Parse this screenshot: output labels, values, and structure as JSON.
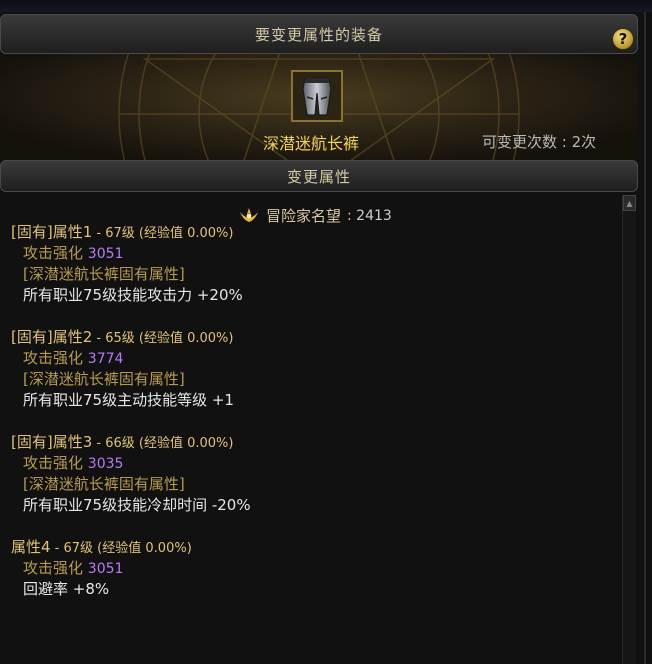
{
  "window": {
    "title": "要变更属性的装备",
    "help_label": "?",
    "help_icon": "question-icon"
  },
  "item": {
    "name": "深潜迷航长裤",
    "change_count": "可变更次数 : 2次",
    "icon": "pants-icon"
  },
  "section": {
    "title": "变更属性"
  },
  "reputation": {
    "label": "冒险家名望",
    "value": ": 2413",
    "icon": "reputation-icon"
  },
  "attributes": [
    {
      "header": "[固有]属性1",
      "level": " - 67级 (经验值 ",
      "exp": "0.00%)",
      "stat_label": "攻击强化",
      "stat_value": "3051",
      "source": "[深潜迷航长裤固有属性]",
      "effect": "所有职业75级技能攻击力 +20%"
    },
    {
      "header": "[固有]属性2",
      "level": " - 65级 (经验值 ",
      "exp": "0.00%)",
      "stat_label": "攻击强化",
      "stat_value": "3774",
      "source": "[深潜迷航长裤固有属性]",
      "effect": "所有职业75级主动技能等级 +1"
    },
    {
      "header": "[固有]属性3",
      "level": " - 66级 (经验值 ",
      "exp": "0.00%)",
      "stat_label": "攻击强化",
      "stat_value": "3035",
      "source": "[深潜迷航长裤固有属性]",
      "effect": "所有职业75级技能冷却时间 -20%"
    },
    {
      "header": "属性4",
      "level": " - 67级 (经验值 ",
      "exp": "0.00%)",
      "stat_label": "攻击强化",
      "stat_value": "3051",
      "effect": "回避率 +8%"
    }
  ],
  "colors": {
    "header": "#e0c27a",
    "source": "#b89a52",
    "value": "#b77cf2",
    "effect": "#e6e6e6",
    "item_name": "#f3d25a"
  }
}
